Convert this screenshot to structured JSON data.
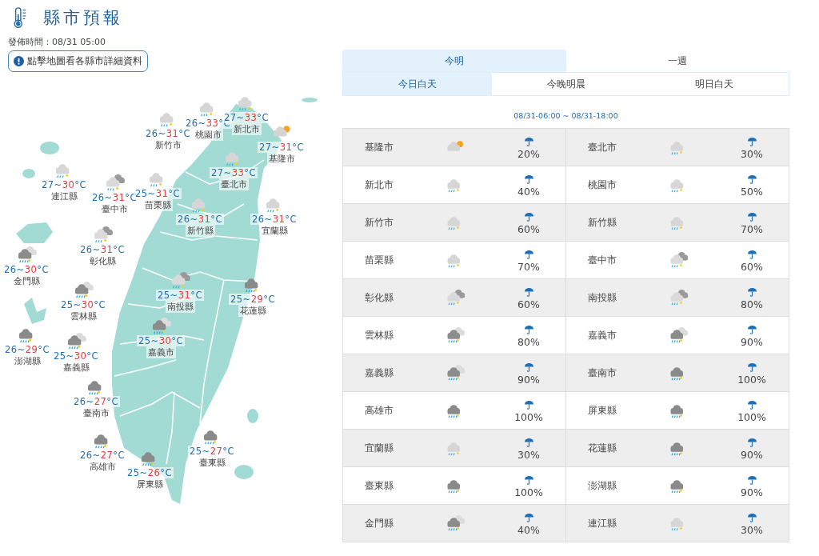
{
  "header": {
    "title": "縣市預報",
    "issued": "發佈時間：08/31 05:00",
    "map_hint_button": "點擊地圖看各縣市詳細資料"
  },
  "map": {
    "counties": [
      {
        "name": "新竹市",
        "kind": "light-shower",
        "low": "26",
        "separator": "~",
        "high": "31",
        "unit": "°C"
      },
      {
        "name": "桃園市",
        "kind": "light-shower",
        "low": "26",
        "separator": "~",
        "high": "33",
        "unit": "°C"
      },
      {
        "name": "新北市",
        "kind": "light-shower",
        "low": "27",
        "separator": "~",
        "high": "33",
        "unit": "°C"
      },
      {
        "name": "基隆市",
        "kind": "sun-cloud",
        "low": "27",
        "separator": "~",
        "high": "31",
        "unit": "°C"
      },
      {
        "name": "臺北市",
        "kind": "light-shower",
        "low": "27",
        "separator": "~",
        "high": "33",
        "unit": "°C"
      },
      {
        "name": "連江縣",
        "kind": "light-shower",
        "low": "27",
        "separator": "~",
        "high": "30",
        "unit": "°C"
      },
      {
        "name": "臺中市",
        "kind": "cloudy-shower",
        "low": "26",
        "separator": "~",
        "high": "31",
        "unit": "°C"
      },
      {
        "name": "苗栗縣",
        "kind": "light-shower",
        "low": "25",
        "separator": "~",
        "high": "31",
        "unit": "°C"
      },
      {
        "name": "新竹縣",
        "kind": "light-shower",
        "low": "26",
        "separator": "~",
        "high": "31",
        "unit": "°C"
      },
      {
        "name": "宜蘭縣",
        "kind": "light-shower",
        "low": "26",
        "separator": "~",
        "high": "31",
        "unit": "°C"
      },
      {
        "name": "彰化縣",
        "kind": "cloudy-shower",
        "low": "26",
        "separator": "~",
        "high": "31",
        "unit": "°C"
      },
      {
        "name": "金門縣",
        "kind": "heavy-shower",
        "low": "26",
        "separator": "~",
        "high": "30",
        "unit": "°C"
      },
      {
        "name": "南投縣",
        "kind": "cloudy-shower",
        "low": "25",
        "separator": "~",
        "high": "31",
        "unit": "°C"
      },
      {
        "name": "花蓮縣",
        "kind": "rain",
        "low": "25",
        "separator": "~",
        "high": "29",
        "unit": "°C"
      },
      {
        "name": "雲林縣",
        "kind": "heavy-shower",
        "low": "25",
        "separator": "~",
        "high": "30",
        "unit": "°C"
      },
      {
        "name": "嘉義市",
        "kind": "heavy-shower",
        "low": "25",
        "separator": "~",
        "high": "30",
        "unit": "°C"
      },
      {
        "name": "澎湖縣",
        "kind": "rain",
        "low": "26",
        "separator": "~",
        "high": "29",
        "unit": "°C"
      },
      {
        "name": "嘉義縣",
        "kind": "heavy-shower",
        "low": "25",
        "separator": "~",
        "high": "30",
        "unit": "°C"
      },
      {
        "name": "臺南市",
        "kind": "rain",
        "low": "26",
        "separator": "~",
        "high": "27",
        "unit": "°C"
      },
      {
        "name": "高雄市",
        "kind": "rain",
        "low": "26",
        "separator": "~",
        "high": "27",
        "unit": "°C"
      },
      {
        "name": "屏東縣",
        "kind": "rain",
        "low": "25",
        "separator": "~",
        "high": "26",
        "unit": "°C"
      },
      {
        "name": "臺東縣",
        "kind": "rain",
        "low": "25",
        "separator": "~",
        "high": "27",
        "unit": "°C"
      }
    ]
  },
  "tabs": [
    {
      "label": "今明",
      "selected": true
    },
    {
      "label": "一週",
      "selected": false
    }
  ],
  "subtabs": [
    {
      "label": "今日白天",
      "selected": true
    },
    {
      "label": "今晚明晨",
      "selected": false
    },
    {
      "label": "明日白天",
      "selected": false
    }
  ],
  "period": "08/31-06:00 ~ 08/31-18:00",
  "table": {
    "rows": [
      [
        {
          "name": "基隆市",
          "kind": "sun-cloud",
          "rain_chance": "20%"
        },
        {
          "name": "臺北市",
          "kind": "light-shower",
          "rain_chance": "30%"
        }
      ],
      [
        {
          "name": "新北市",
          "kind": "light-shower",
          "rain_chance": "40%"
        },
        {
          "name": "桃園市",
          "kind": "light-shower",
          "rain_chance": "50%"
        }
      ],
      [
        {
          "name": "新竹市",
          "kind": "light-shower",
          "rain_chance": "60%"
        },
        {
          "name": "新竹縣",
          "kind": "light-shower",
          "rain_chance": "70%"
        }
      ],
      [
        {
          "name": "苗栗縣",
          "kind": "light-shower",
          "rain_chance": "70%"
        },
        {
          "name": "臺中市",
          "kind": "cloudy-shower",
          "rain_chance": "60%"
        }
      ],
      [
        {
          "name": "彰化縣",
          "kind": "cloudy-shower",
          "rain_chance": "60%"
        },
        {
          "name": "南投縣",
          "kind": "cloudy-shower",
          "rain_chance": "80%"
        }
      ],
      [
        {
          "name": "雲林縣",
          "kind": "heavy-shower",
          "rain_chance": "80%"
        },
        {
          "name": "嘉義市",
          "kind": "heavy-shower",
          "rain_chance": "90%"
        }
      ],
      [
        {
          "name": "嘉義縣",
          "kind": "heavy-shower",
          "rain_chance": "90%"
        },
        {
          "name": "臺南市",
          "kind": "rain",
          "rain_chance": "100%"
        }
      ],
      [
        {
          "name": "高雄市",
          "kind": "rain",
          "rain_chance": "100%"
        },
        {
          "name": "屏東縣",
          "kind": "rain",
          "rain_chance": "100%"
        }
      ],
      [
        {
          "name": "宜蘭縣",
          "kind": "light-shower",
          "rain_chance": "30%"
        },
        {
          "name": "花蓮縣",
          "kind": "rain",
          "rain_chance": "90%"
        }
      ],
      [
        {
          "name": "臺東縣",
          "kind": "rain",
          "rain_chance": "100%"
        },
        {
          "name": "澎湖縣",
          "kind": "rain",
          "rain_chance": "90%"
        }
      ],
      [
        {
          "name": "金門縣",
          "kind": "heavy-shower",
          "rain_chance": "40%"
        },
        {
          "name": "連江縣",
          "kind": "light-shower",
          "rain_chance": "30%"
        }
      ]
    ]
  }
}
